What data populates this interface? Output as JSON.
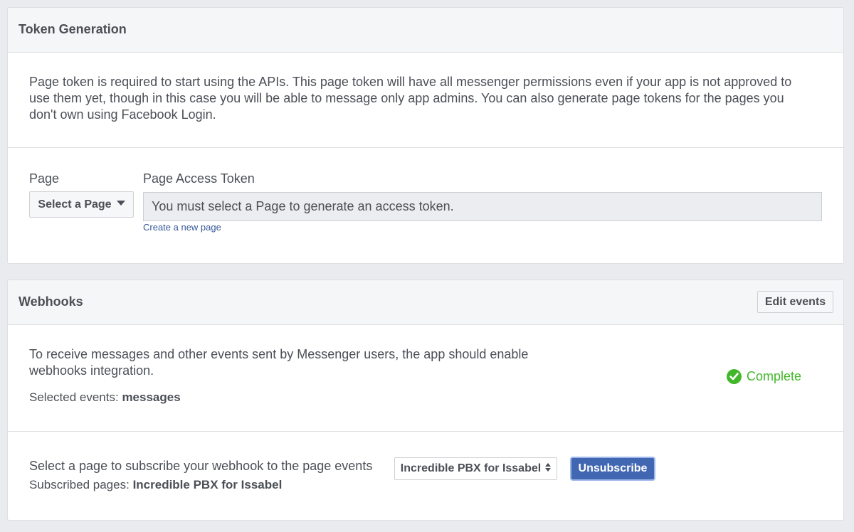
{
  "token_generation": {
    "title": "Token Generation",
    "description": "Page token is required to start using the APIs. This page token will have all messenger permissions even if your app is not approved to use them yet, though in this case you will be able to message only app admins. You can also generate page tokens for the pages you don't own using Facebook Login.",
    "page_label": "Page",
    "select_page_button": "Select a Page",
    "access_token_label": "Page Access Token",
    "access_token_placeholder": "You must select a Page to generate an access token.",
    "create_page_link": "Create a new page"
  },
  "webhooks": {
    "title": "Webhooks",
    "edit_events_button": "Edit events",
    "description": "To receive messages and other events sent by Messenger users, the app should enable webhooks integration.",
    "selected_events_label": "Selected events:",
    "selected_events_value": "messages",
    "status": "Complete",
    "subscribe_text": "Select a page to subscribe your webhook to the page events",
    "subscribed_pages_label": "Subscribed pages:",
    "subscribed_pages_value": "Incredible PBX for Issabel",
    "page_select_value": "Incredible PBX for Issabel",
    "unsubscribe_button": "Unsubscribe"
  },
  "colors": {
    "background": "#e9ebee",
    "primary": "#4267b2",
    "success": "#42b72a",
    "link": "#365899"
  },
  "icons": [
    "chevron-down-icon",
    "check-circle-icon",
    "up-down-arrows-icon"
  ]
}
